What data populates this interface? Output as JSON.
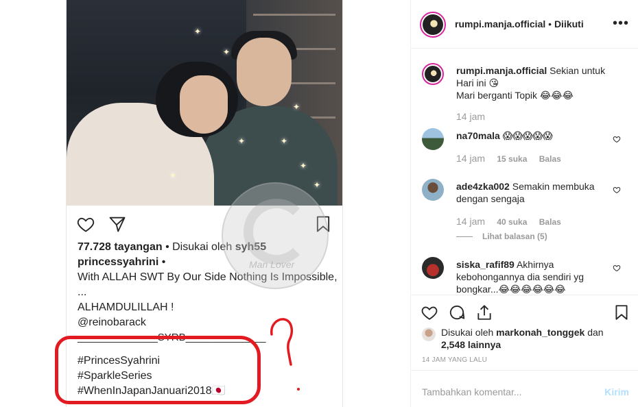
{
  "post": {
    "views": "77.728 tayangan",
    "liked_prefix": "• Disukai oleh",
    "liked_by": "syh55",
    "author": "princessyahrini",
    "author_suffix": "•",
    "caption_1": "With ALLAH SWT By Our Side Nothing Is Impossible,",
    "caption_2": "...",
    "caption_3": "ALHAMDULILLAH !",
    "mention": "@reinobarack",
    "signature": "______________SYRB______________",
    "tags": [
      "#PrincesSyahrini",
      "#SparkleSeries",
      "#WhenInJapanJanuari2018🇯🇵"
    ],
    "watermark": "Man   Lover"
  },
  "header": {
    "username": "rumpi.manja.official",
    "dot": "•",
    "follow": "Diikuti",
    "more": "•••"
  },
  "comments": [
    {
      "user": "rumpi.manja.official",
      "text": "Sekian untuk Hari ini 😘",
      "text2": "Mari berganti Topik 😂😂😂",
      "time": "14 jam"
    },
    {
      "user": "na70mala",
      "text": "😱😱😱😱😱",
      "time": "14 jam",
      "likes": "15 suka",
      "reply": "Balas"
    },
    {
      "user": "ade4zka002",
      "text": "Semakin membuka dengan sengaja",
      "time": "14 jam",
      "likes": "40 suka",
      "reply": "Balas",
      "view_replies": "Lihat balasan (5)"
    },
    {
      "user": "siska_rafif89",
      "text": "Akhirnya kebohongannya dia sendiri yg bongkar...😂😂😂😂😂😂"
    }
  ],
  "likes_line": {
    "prefix": "Disukai oleh",
    "user": "markonah_tonggek",
    "and": "dan",
    "count": "2,548 lainnya"
  },
  "time_ago": "14 JAM YANG LALU",
  "composer": {
    "placeholder": "Tambahkan komentar...",
    "send": "Kirim"
  },
  "colors": {
    "annotation_red": "#e21a22",
    "send_disabled": "#b2dffc"
  }
}
